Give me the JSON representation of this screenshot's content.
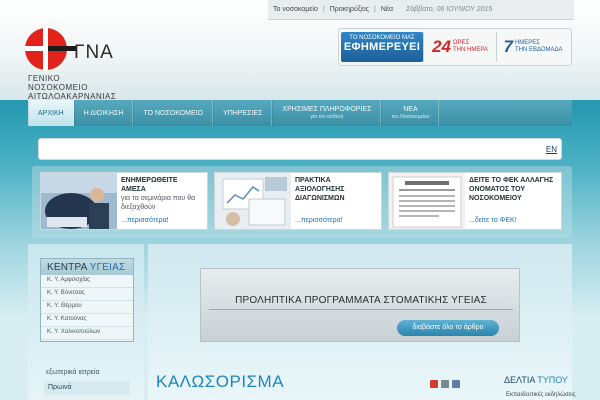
{
  "toplinks": {
    "items": [
      "Το νοσοκομείο",
      "Προκηρύξεις",
      "Νέα"
    ],
    "date": "Σάββατο, 06 ΙΟΥΝΙΟΥ 2015"
  },
  "logo": {
    "title": "ΓΝΑ",
    "sub1": "ΓΕΝΙΚΟ",
    "sub2": "ΝΟΣΟΚΟΜΕΙΟ",
    "sub3": "ΑΙΤΩΛΟΑΚΑΡΝΑΝΙΑΣ"
  },
  "duty": {
    "small": "ΤΟ ΝΟΣΟΚΟΜΕΙΟ ΜΑΣ",
    "big": "ΕΦΗΜΕΡΕΥΕΙ",
    "n1": "24",
    "t1a": "ΩΡΕΣ",
    "t1b": "ΤΗΝ ΗΜΕΡΑ",
    "n2": "7",
    "t2a": "ΗΜΕΡΕΣ",
    "t2b": "ΤΗΝ ΕΒΔΟΜΑΔΑ"
  },
  "nav": [
    {
      "label": "ΑΡΧΙΚΗ",
      "sub": ""
    },
    {
      "label": "Η ΔΙΟΙΚΗΣΗ",
      "sub": ""
    },
    {
      "label": "ΤΟ ΝΟΣΟΚΟΜΕΙΟ",
      "sub": ""
    },
    {
      "label": "ΥΠΗΡΕΣΙΕΣ",
      "sub": ""
    },
    {
      "label": "ΧΡΗΣΙΜΕΣ ΠΛΗΡΟΦΟΡΙΕΣ",
      "sub": "για τον ασθενή"
    },
    {
      "label": "ΝΕΑ",
      "sub": "του Νοσοκομείου"
    }
  ],
  "bar": {
    "en": "EN"
  },
  "promos": [
    {
      "title": "ΕΝΗΜΕΡΩΘΕΙΤΕ ΑΜΕΣΑ",
      "desc": "για τα σεμινάρια που θα διεξαχθούν",
      "more": "...περισσότερα!"
    },
    {
      "title": "ΠΡΑΚΤΙΚΑ ΑΞΙΟΛΟΓΗΣΗΣ ΔΙΑΓΩΝΙΣΜΩΝ",
      "desc": "",
      "more": "...περισσότερα!"
    },
    {
      "title": "ΔΕΙΤΕ ΤΟ ΦΕΚ ΑΛΛΑΓΗΣ ΟΝΟΜΑΤΟΣ ΤΟΥ ΝΟΣΟΚΟΜΕΙΟΥ",
      "desc": "",
      "more": "...δείτε το ΦΕΚ!"
    }
  ],
  "centers": {
    "title_a": "ΚΕΝΤΡΑ ",
    "title_b": "ΥΓΕΙΑΣ",
    "items": [
      "Κ. Υ. Αμφιλοχίας",
      "Κ. Υ. Βόνιτσας",
      "Κ. Υ. Θέρμου",
      "Κ. Υ. Κατούνας",
      "Κ. Υ. Χαλκιοπούλων"
    ]
  },
  "external": {
    "label": "εξωτερικά ιατρεία",
    "first": "Πρωινά"
  },
  "feature": {
    "title": "ΠΡΟΛΗΠΤΙΚΑ ΠΡΟΓΡΑΜΜΑΤΑ ΣΤΟΜΑΤΙΚΗΣ ΥΓΕΙΑΣ",
    "button": "διαβάστε όλο το άρθρο"
  },
  "welcome": "ΚΑΛΩΣΟΡΙΣΜΑ",
  "press": {
    "title_a": "ΔΕΛΤΙΑ ",
    "title_b": "ΤΥΠΟΥ",
    "first": "Εκπαιδευτικές εκδηλώσεις"
  },
  "colors": {
    "accent": "#1f86b8",
    "logo_red": "#e0231b",
    "duty_red": "#d8232a",
    "duty_blue": "#1d5f99"
  }
}
